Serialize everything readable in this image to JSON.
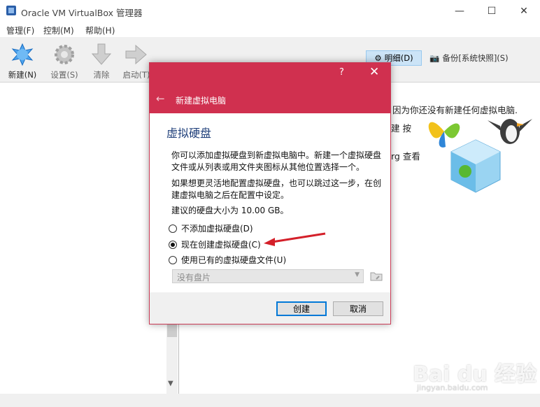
{
  "window": {
    "title": "Oracle VM VirtualBox 管理器",
    "min": "—",
    "max": "☐",
    "close": "✕"
  },
  "menu": [
    "管理(F)",
    "控制(M)",
    "帮助(H)"
  ],
  "toolbar": {
    "new": "新建(N)",
    "settings": "设置(S)",
    "discard": "清除",
    "start": "启动(T)",
    "details": "明细(D)",
    "snapshots": "备份[系统快照](S)"
  },
  "welcome": {
    "line1": "因为你还没有新建任何虚拟电脑.",
    "line2": "建 按",
    "line3": "rg 查看"
  },
  "dialog": {
    "help": "?",
    "close": "✕",
    "back": "←",
    "title": "新建虚拟电脑",
    "heading": "虚拟硬盘",
    "para1": "你可以添加虚拟硬盘到新虚拟电脑中。新建一个虚拟硬盘文件或从列表或用文件夹图标从其他位置选择一个。",
    "para2": "如果想更灵活地配置虚拟硬盘，也可以跳过这一步，在创建虚拟电脑之后在配置中设定。",
    "para3": "建议的硬盘大小为 10.00 GB。",
    "options": [
      {
        "label": "不添加虚拟硬盘(D)",
        "checked": false
      },
      {
        "label": "现在创建虚拟硬盘(C)",
        "checked": true
      },
      {
        "label": "使用已有的虚拟硬盘文件(U)",
        "checked": false
      }
    ],
    "combo": "没有盘片",
    "create": "创建",
    "cancel": "取消"
  },
  "watermark": {
    "main": "Bai du 经验",
    "sub": "jingyan.baidu.com"
  },
  "colors": {
    "dialog_header": "#d0304f",
    "heading": "#1f3f7a",
    "arrow": "#d4202a"
  }
}
